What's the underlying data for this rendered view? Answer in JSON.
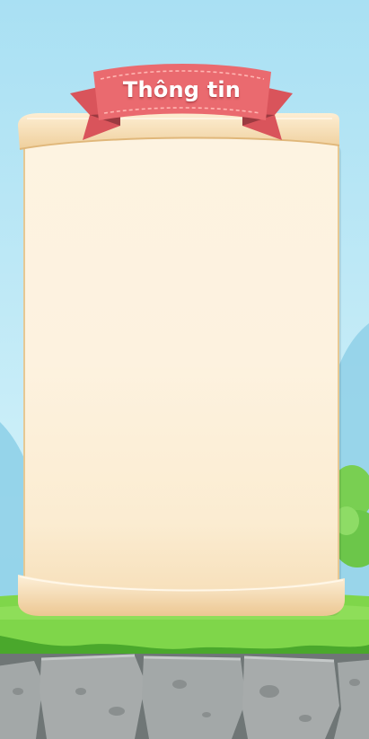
{
  "screen": {
    "title": "Thông tin"
  },
  "colors": {
    "sky": "#b9e7f5",
    "grass": "#6fcf3d",
    "grass_dark": "#4aa82c",
    "stone": "#9ea3a3",
    "parchment": "#fcf0da",
    "parchment_edge": "#f1d6a8",
    "ribbon": "#e8666b",
    "ribbon_dark": "#b94a52"
  },
  "panel": {
    "content_items": []
  }
}
